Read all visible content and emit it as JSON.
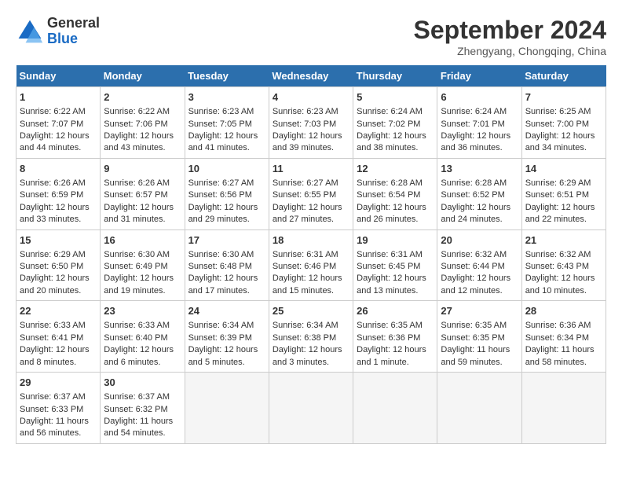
{
  "header": {
    "logo_line1": "General",
    "logo_line2": "Blue",
    "month_title": "September 2024",
    "subtitle": "Zhengyang, Chongqing, China"
  },
  "weekdays": [
    "Sunday",
    "Monday",
    "Tuesday",
    "Wednesday",
    "Thursday",
    "Friday",
    "Saturday"
  ],
  "weeks": [
    [
      {
        "day": "1",
        "lines": [
          "Sunrise: 6:22 AM",
          "Sunset: 7:07 PM",
          "Daylight: 12 hours",
          "and 44 minutes."
        ]
      },
      {
        "day": "2",
        "lines": [
          "Sunrise: 6:22 AM",
          "Sunset: 7:06 PM",
          "Daylight: 12 hours",
          "and 43 minutes."
        ]
      },
      {
        "day": "3",
        "lines": [
          "Sunrise: 6:23 AM",
          "Sunset: 7:05 PM",
          "Daylight: 12 hours",
          "and 41 minutes."
        ]
      },
      {
        "day": "4",
        "lines": [
          "Sunrise: 6:23 AM",
          "Sunset: 7:03 PM",
          "Daylight: 12 hours",
          "and 39 minutes."
        ]
      },
      {
        "day": "5",
        "lines": [
          "Sunrise: 6:24 AM",
          "Sunset: 7:02 PM",
          "Daylight: 12 hours",
          "and 38 minutes."
        ]
      },
      {
        "day": "6",
        "lines": [
          "Sunrise: 6:24 AM",
          "Sunset: 7:01 PM",
          "Daylight: 12 hours",
          "and 36 minutes."
        ]
      },
      {
        "day": "7",
        "lines": [
          "Sunrise: 6:25 AM",
          "Sunset: 7:00 PM",
          "Daylight: 12 hours",
          "and 34 minutes."
        ]
      }
    ],
    [
      {
        "day": "8",
        "lines": [
          "Sunrise: 6:26 AM",
          "Sunset: 6:59 PM",
          "Daylight: 12 hours",
          "and 33 minutes."
        ]
      },
      {
        "day": "9",
        "lines": [
          "Sunrise: 6:26 AM",
          "Sunset: 6:57 PM",
          "Daylight: 12 hours",
          "and 31 minutes."
        ]
      },
      {
        "day": "10",
        "lines": [
          "Sunrise: 6:27 AM",
          "Sunset: 6:56 PM",
          "Daylight: 12 hours",
          "and 29 minutes."
        ]
      },
      {
        "day": "11",
        "lines": [
          "Sunrise: 6:27 AM",
          "Sunset: 6:55 PM",
          "Daylight: 12 hours",
          "and 27 minutes."
        ]
      },
      {
        "day": "12",
        "lines": [
          "Sunrise: 6:28 AM",
          "Sunset: 6:54 PM",
          "Daylight: 12 hours",
          "and 26 minutes."
        ]
      },
      {
        "day": "13",
        "lines": [
          "Sunrise: 6:28 AM",
          "Sunset: 6:52 PM",
          "Daylight: 12 hours",
          "and 24 minutes."
        ]
      },
      {
        "day": "14",
        "lines": [
          "Sunrise: 6:29 AM",
          "Sunset: 6:51 PM",
          "Daylight: 12 hours",
          "and 22 minutes."
        ]
      }
    ],
    [
      {
        "day": "15",
        "lines": [
          "Sunrise: 6:29 AM",
          "Sunset: 6:50 PM",
          "Daylight: 12 hours",
          "and 20 minutes."
        ]
      },
      {
        "day": "16",
        "lines": [
          "Sunrise: 6:30 AM",
          "Sunset: 6:49 PM",
          "Daylight: 12 hours",
          "and 19 minutes."
        ]
      },
      {
        "day": "17",
        "lines": [
          "Sunrise: 6:30 AM",
          "Sunset: 6:48 PM",
          "Daylight: 12 hours",
          "and 17 minutes."
        ]
      },
      {
        "day": "18",
        "lines": [
          "Sunrise: 6:31 AM",
          "Sunset: 6:46 PM",
          "Daylight: 12 hours",
          "and 15 minutes."
        ]
      },
      {
        "day": "19",
        "lines": [
          "Sunrise: 6:31 AM",
          "Sunset: 6:45 PM",
          "Daylight: 12 hours",
          "and 13 minutes."
        ]
      },
      {
        "day": "20",
        "lines": [
          "Sunrise: 6:32 AM",
          "Sunset: 6:44 PM",
          "Daylight: 12 hours",
          "and 12 minutes."
        ]
      },
      {
        "day": "21",
        "lines": [
          "Sunrise: 6:32 AM",
          "Sunset: 6:43 PM",
          "Daylight: 12 hours",
          "and 10 minutes."
        ]
      }
    ],
    [
      {
        "day": "22",
        "lines": [
          "Sunrise: 6:33 AM",
          "Sunset: 6:41 PM",
          "Daylight: 12 hours",
          "and 8 minutes."
        ]
      },
      {
        "day": "23",
        "lines": [
          "Sunrise: 6:33 AM",
          "Sunset: 6:40 PM",
          "Daylight: 12 hours",
          "and 6 minutes."
        ]
      },
      {
        "day": "24",
        "lines": [
          "Sunrise: 6:34 AM",
          "Sunset: 6:39 PM",
          "Daylight: 12 hours",
          "and 5 minutes."
        ]
      },
      {
        "day": "25",
        "lines": [
          "Sunrise: 6:34 AM",
          "Sunset: 6:38 PM",
          "Daylight: 12 hours",
          "and 3 minutes."
        ]
      },
      {
        "day": "26",
        "lines": [
          "Sunrise: 6:35 AM",
          "Sunset: 6:36 PM",
          "Daylight: 12 hours",
          "and 1 minute."
        ]
      },
      {
        "day": "27",
        "lines": [
          "Sunrise: 6:35 AM",
          "Sunset: 6:35 PM",
          "Daylight: 11 hours",
          "and 59 minutes."
        ]
      },
      {
        "day": "28",
        "lines": [
          "Sunrise: 6:36 AM",
          "Sunset: 6:34 PM",
          "Daylight: 11 hours",
          "and 58 minutes."
        ]
      }
    ],
    [
      {
        "day": "29",
        "lines": [
          "Sunrise: 6:37 AM",
          "Sunset: 6:33 PM",
          "Daylight: 11 hours",
          "and 56 minutes."
        ]
      },
      {
        "day": "30",
        "lines": [
          "Sunrise: 6:37 AM",
          "Sunset: 6:32 PM",
          "Daylight: 11 hours",
          "and 54 minutes."
        ]
      },
      null,
      null,
      null,
      null,
      null
    ]
  ]
}
